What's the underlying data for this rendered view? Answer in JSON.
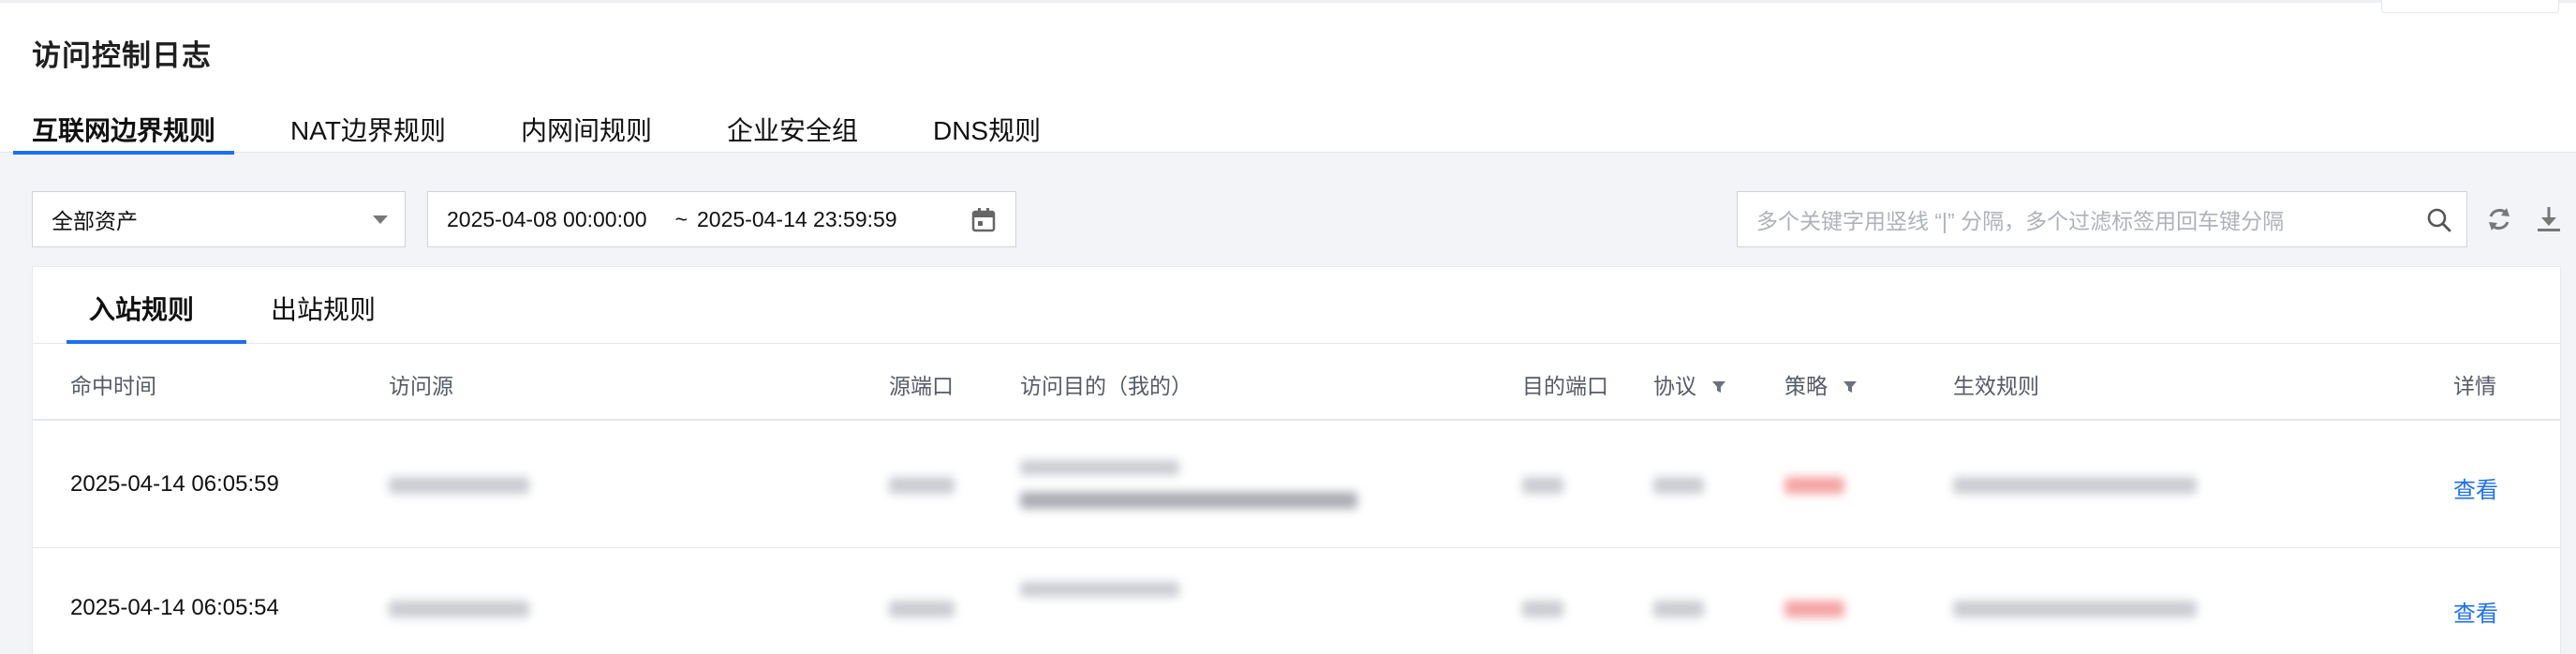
{
  "page": {
    "title": "访问控制日志"
  },
  "tabs": [
    {
      "label": "互联网边界规则",
      "active": true
    },
    {
      "label": "NAT边界规则",
      "active": false
    },
    {
      "label": "内网间规则",
      "active": false
    },
    {
      "label": "企业安全组",
      "active": false
    },
    {
      "label": "DNS规则",
      "active": false
    }
  ],
  "filters": {
    "asset_select": "全部资产",
    "date_start": "2025-04-08 00:00:00",
    "date_sep": "~",
    "date_end": "2025-04-14 23:59:59",
    "search_placeholder": "多个关键字用竖线 “|” 分隔，多个过滤标签用回车键分隔"
  },
  "subtabs": [
    {
      "label": "入站规则",
      "active": true
    },
    {
      "label": "出站规则",
      "active": false
    }
  ],
  "table": {
    "columns": [
      "命中时间",
      "访问源",
      "源端口",
      "访问目的（我的）",
      "目的端口",
      "协议",
      "策略",
      "生效规则",
      "详情"
    ],
    "rows": [
      {
        "time": "2025-04-14 06:05:59",
        "detail": "查看"
      },
      {
        "time": "2025-04-14 06:05:54",
        "detail": "查看"
      }
    ]
  },
  "icons": {
    "calendar": "calendar-icon",
    "search": "search-icon",
    "refresh": "refresh-icon",
    "download": "download-icon",
    "filter": "filter-icon"
  },
  "colors": {
    "accent": "#1d6ff2",
    "link": "#1d6ff2",
    "muted": "#555b66"
  }
}
